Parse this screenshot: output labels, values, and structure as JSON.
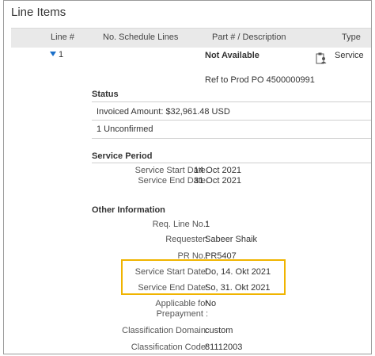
{
  "title": "Line Items",
  "columns": {
    "line": "Line #",
    "schedule": "No. Schedule Lines",
    "part": "Part # / Description",
    "type": "Type"
  },
  "row": {
    "line_number": "1",
    "part": "Not Available",
    "type": "Service",
    "ref": "Ref to Prod PO 4500000991",
    "type_icon": "clipboard-person-icon"
  },
  "status": {
    "heading": "Status",
    "invoiced": "Invoiced Amount:  $32,961.48 USD",
    "unconfirmed": "1 Unconfirmed"
  },
  "service_period": {
    "heading": "Service Period",
    "start_label": "Service Start Date:",
    "start_value": "14 Oct 2021",
    "end_label": "Service End Date:",
    "end_value": "31 Oct 2021"
  },
  "other": {
    "heading": "Other Information",
    "req_line_label": "Req. Line No.:",
    "req_line_value": "1",
    "requester_label": "Requester:",
    "requester_value": "Sabeer Shaik",
    "pr_label": "PR No.:",
    "pr_value": "PR5407",
    "start_label": "Service Start Date:",
    "start_value": "Do, 14. Okt 2021",
    "end_label": "Service End Date:",
    "end_value": "So, 31. Okt 2021",
    "prepay_label_1": "Applicable for",
    "prepay_label_2": "Prepayment :",
    "prepay_value": "No",
    "class_domain_label": "Classification Domain:",
    "class_domain_value": "custom",
    "class_code_label": "Classification Code:",
    "class_code_value": "81112003"
  },
  "highlight_color": "#f0b400"
}
